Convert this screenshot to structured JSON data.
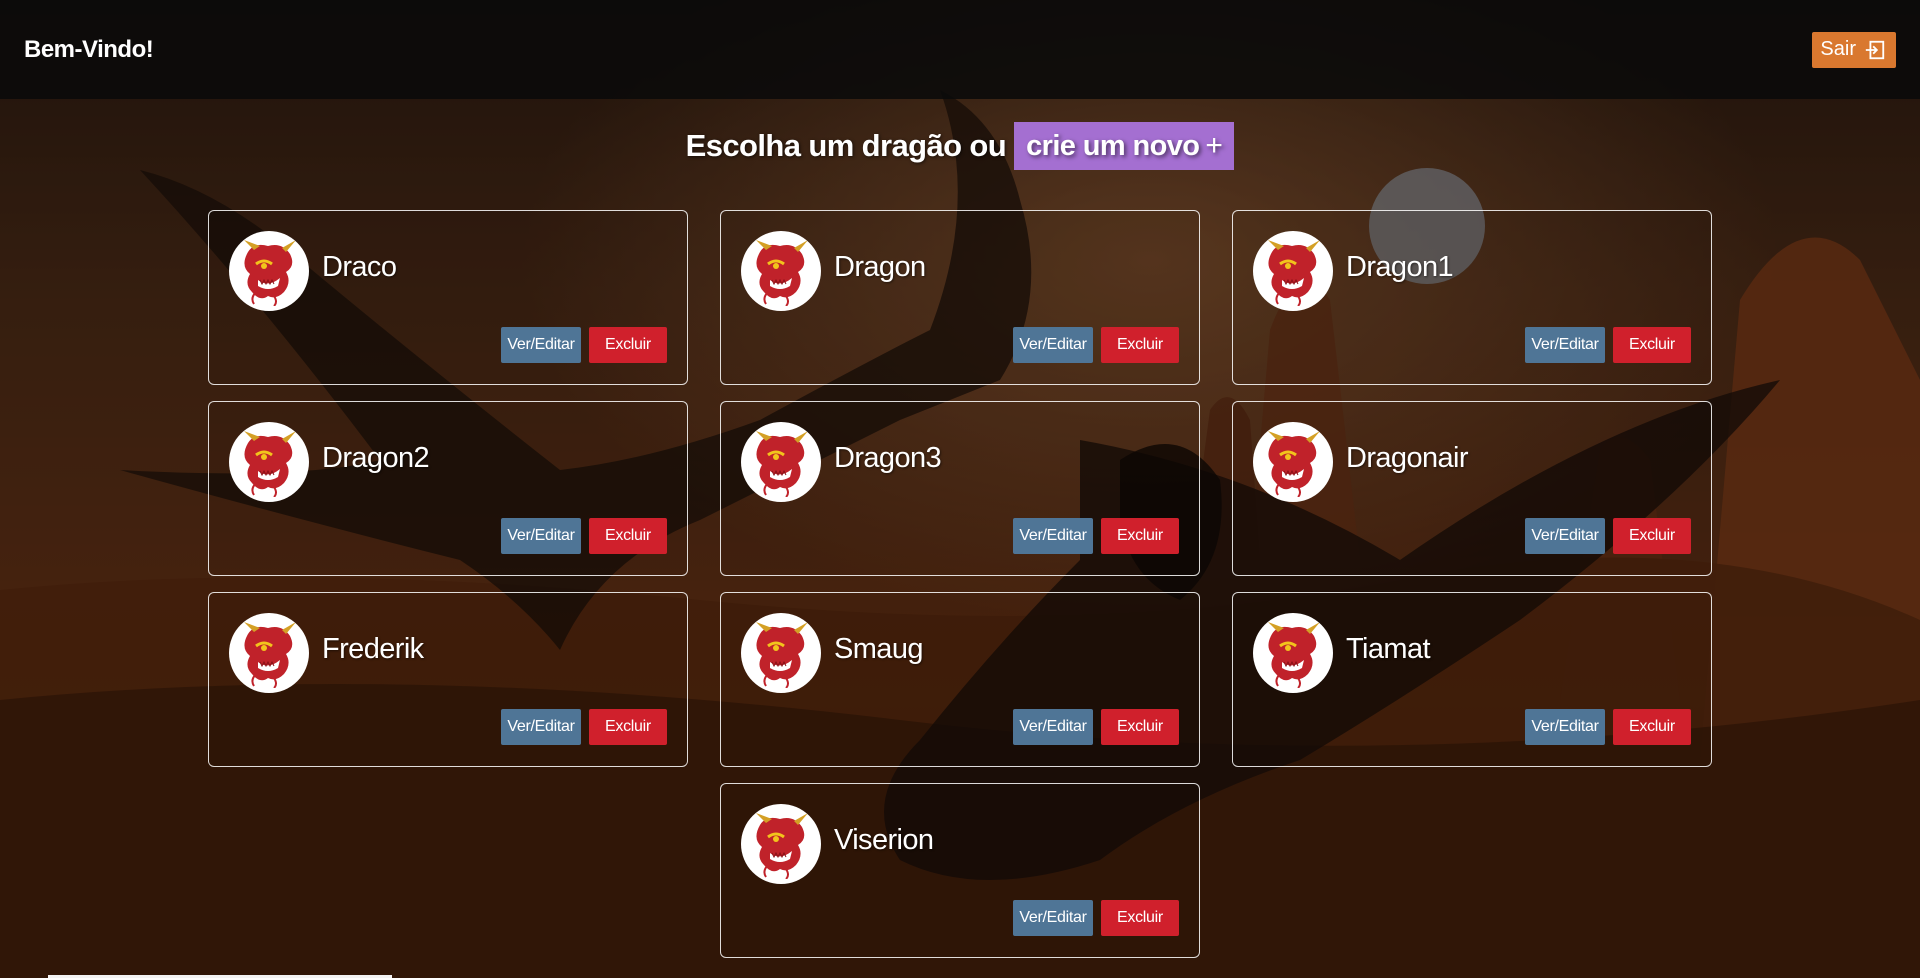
{
  "header": {
    "brand": "Bem-Vindo!",
    "logout_label": "Sair"
  },
  "main": {
    "heading": "Escolha um dragão ou",
    "create_label": "crie um novo",
    "create_icon": "+",
    "view_label": "Ver/Editar",
    "delete_label": "Excluir",
    "dragons": [
      {
        "name": "Draco"
      },
      {
        "name": "Dragon"
      },
      {
        "name": "Dragon1"
      },
      {
        "name": "Dragon2"
      },
      {
        "name": "Dragon3"
      },
      {
        "name": "Dragonair"
      },
      {
        "name": "Frederik"
      },
      {
        "name": "Smaug"
      },
      {
        "name": "Tiamat"
      },
      {
        "name": "Viserion"
      }
    ]
  },
  "colors": {
    "logout": "#d9782f",
    "create": "#a46fd1",
    "view": "#4f7596",
    "delete": "#d0202c"
  },
  "icons": {
    "logout": "logout-icon",
    "avatar": "dragon-head-icon"
  }
}
